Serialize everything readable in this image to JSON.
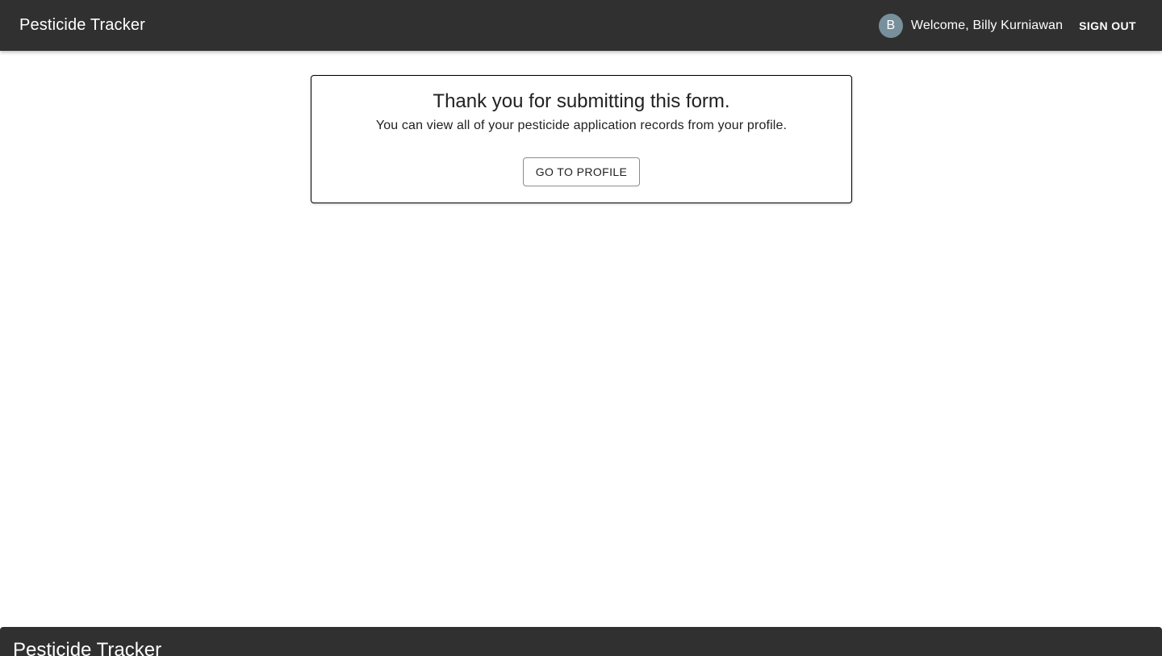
{
  "header": {
    "title": "Pesticide Tracker",
    "avatar_initial": "B",
    "welcome_text": "Welcome, Billy Kurniawan",
    "signout_label": "SIGN OUT"
  },
  "confirmation": {
    "title": "Thank you for submitting this form.",
    "message": "You can view all of your pesticide application records from your profile.",
    "button_label": "GO TO PROFILE"
  },
  "footer": {
    "title": "Pesticide Tracker"
  },
  "colors": {
    "appbar_bg": "#303030",
    "avatar_bg": "#78909c"
  }
}
